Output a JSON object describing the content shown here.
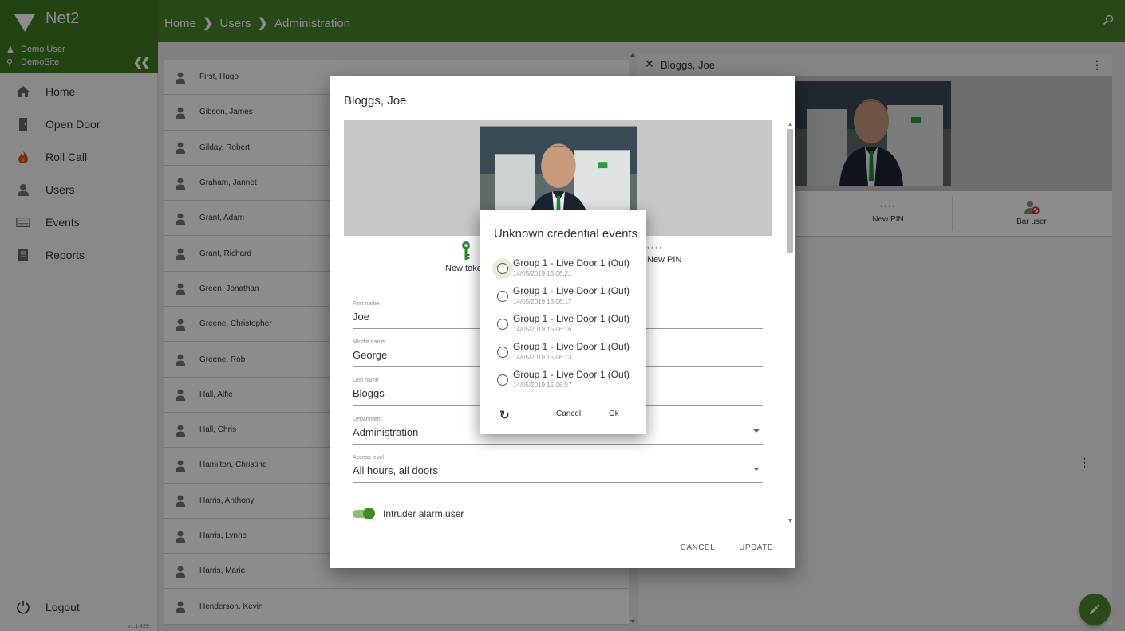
{
  "app": {
    "title": "Net2",
    "version": "v1.1.429"
  },
  "colors": {
    "brand_green": "#48862a",
    "dark_green": "#3e7a22"
  },
  "breadcrumb": {
    "items": [
      "Home",
      "Users",
      "Administration"
    ]
  },
  "session": {
    "user": "Demo User",
    "site": "DemoSite"
  },
  "nav": {
    "items": [
      {
        "label": "Home",
        "icon": "home-icon"
      },
      {
        "label": "Open Door",
        "icon": "door-icon"
      },
      {
        "label": "Roll Call",
        "icon": "fire-icon"
      },
      {
        "label": "Users",
        "icon": "user-icon"
      },
      {
        "label": "Events",
        "icon": "events-icon"
      },
      {
        "label": "Reports",
        "icon": "reports-icon"
      }
    ],
    "logout": "Logout"
  },
  "users": [
    "First, Hugo",
    "Gibson, James",
    "Gilday, Robert",
    "Graham, Jannet",
    "Grant, Adam",
    "Grant, Richard",
    "Green, Jonathan",
    "Greene, Christopher",
    "Greene, Rob",
    "Hall, Alfie",
    "Hall, Chris",
    "Hamilton, Christine",
    "Harris, Anthony",
    "Harris, Lynne",
    "Harris, Marie",
    "Henderson, Kevin"
  ],
  "detail_panel": {
    "title": "Bloggs, Joe",
    "pin_dots": "••••",
    "pin_label": "New PIN",
    "bar_label": "Bar user"
  },
  "edit_dialog": {
    "title": "Bloggs, Joe",
    "token_label": "New token",
    "pin_dots": "••••",
    "pin_label": "New PIN",
    "fields": {
      "first_name": {
        "label": "First name",
        "value": "Joe"
      },
      "middle_name": {
        "label": "Middle name",
        "value": "George"
      },
      "last_name": {
        "label": "Last name",
        "value": "Bloggs"
      },
      "department": {
        "label": "Department",
        "value": "Administration"
      },
      "access_level": {
        "label": "Access level",
        "value": "All hours, all doors"
      }
    },
    "intruder_toggle": {
      "label": "Intruder alarm user",
      "on": true
    },
    "cancel": "CANCEL",
    "update": "UPDATE"
  },
  "credential_popup": {
    "title": "Unknown credential events",
    "events": [
      {
        "name": "Group 1 - Live Door 1 (Out)",
        "time": "14/05/2019 15:06:21"
      },
      {
        "name": "Group 1 - Live Door 1 (Out)",
        "time": "14/05/2019 15:06:17"
      },
      {
        "name": "Group 1 - Live Door 1 (Out)",
        "time": "14/05/2019 15:06:16"
      },
      {
        "name": "Group 1 - Live Door 1 (Out)",
        "time": "14/05/2019 15:06:13"
      },
      {
        "name": "Group 1 - Live Door 1 (Out)",
        "time": "14/05/2019 15:06:07"
      }
    ],
    "cancel": "Cancel",
    "ok": "Ok"
  }
}
